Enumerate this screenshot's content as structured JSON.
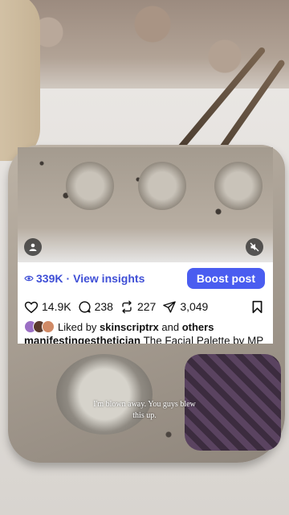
{
  "insights": {
    "views": "339K",
    "separator": "·",
    "link_label": "View insights",
    "boost_label": "Boost post"
  },
  "actions": {
    "likes": "14.9K",
    "comments": "238",
    "reposts": "227",
    "shares": "3,049"
  },
  "liked_by": {
    "prefix": "Liked by",
    "user": "skinscriptrx",
    "joiner": "and",
    "others": "others"
  },
  "caption": {
    "username": "manifestingesthetician",
    "text": "The Facial Palette by MP in action!!! There’s something so cool about holding something in your hands that once… more"
  },
  "video_subtitle": {
    "line1": "I'm blown away. You guys blew",
    "line2": "this up."
  },
  "colors": {
    "accent": "#4a5df0",
    "link": "#3f4fd6"
  }
}
